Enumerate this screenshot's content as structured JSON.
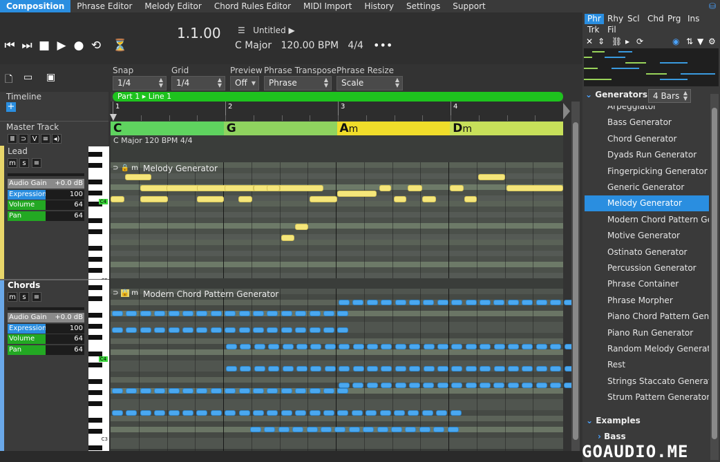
{
  "menu": {
    "tabs": [
      "Composition",
      "Phrase Editor",
      "Melody Editor",
      "Chord Rules Editor",
      "MIDI Import",
      "History",
      "Settings",
      "Support"
    ],
    "active_tab": "Composition"
  },
  "transport": {
    "position": "1.1.00",
    "title": "Untitled",
    "key": "C Major",
    "tempo": "120.00 BPM",
    "time_signature": "4/4",
    "more": "•••"
  },
  "controls": {
    "snap_label": "Snap",
    "snap_value": "1/4",
    "grid_label": "Grid",
    "grid_value": "1/4",
    "preview_label": "Preview",
    "preview_value": "Off",
    "transpose_label": "Phrase Transpose",
    "transpose_value": "Phrase",
    "resize_label": "Phrase Resize",
    "resize_value": "Scale"
  },
  "left_panel": {
    "timeline_label": "Timeline",
    "master_track_label": "Master Track",
    "tracks": [
      {
        "name": "Lead",
        "params": [
          {
            "name": "Audio Gain",
            "value": "+0.0 dB",
            "color": "#8a8a8a"
          },
          {
            "name": "Expression",
            "value": "100",
            "color": "#2a8ee0"
          },
          {
            "name": "Volume",
            "value": "64",
            "color": "#23a823"
          },
          {
            "name": "Pan",
            "value": "64",
            "color": "#23a823"
          }
        ]
      },
      {
        "name": "Chords",
        "params": [
          {
            "name": "Audio Gain",
            "value": "+0.0 dB",
            "color": "#8a8a8a"
          },
          {
            "name": "Expression",
            "value": "100",
            "color": "#2a8ee0"
          },
          {
            "name": "Volume",
            "value": "64",
            "color": "#23a823"
          },
          {
            "name": "Pan",
            "value": "64",
            "color": "#23a823"
          }
        ]
      }
    ],
    "key_labels": [
      "C4",
      "C5",
      "C4",
      "C3"
    ]
  },
  "arrangement": {
    "part_label": "Part 1 ▸ Line 1",
    "bars": [
      "1",
      "2",
      "3",
      "4"
    ],
    "chords": [
      {
        "root": "C",
        "suffix": "",
        "color": "#5fd35f"
      },
      {
        "root": "G",
        "suffix": "",
        "color": "#8fd35f"
      },
      {
        "root": "A",
        "suffix": "m",
        "color": "#f0dd2a"
      },
      {
        "root": "D",
        "suffix": "m",
        "color": "#c7e05a"
      }
    ],
    "chord_info": "C Major  120 BPM  4/4",
    "lanes": [
      {
        "generator": "Melody Generator"
      },
      {
        "generator": "Modern Chord Pattern Generator"
      }
    ]
  },
  "right_panel": {
    "tabs": [
      "Phr",
      "Rhy",
      "Scl",
      "Chd",
      "Prg",
      "Ins",
      "Trk",
      "Fil"
    ],
    "active_tab": "Phr",
    "generators_header": "Generators",
    "bars_value": "4 Bars",
    "generators": [
      "Arpeggiator",
      "Bass Generator",
      "Chord Generator",
      "Dyads Run Generator",
      "Fingerpicking Generator",
      "Generic Generator",
      "Melody Generator",
      "Modern Chord Pattern Generator",
      "Motive Generator",
      "Ostinato Generator",
      "Percussion Generator",
      "Phrase Container",
      "Phrase Morpher",
      "Piano Chord Pattern Generator",
      "Piano Run Generator",
      "Random Melody Generator",
      "Rest",
      "Strings Staccato Generator",
      "Strum Pattern Generator"
    ],
    "selected_generator": "Melody Generator",
    "examples_header": "Examples",
    "bass_header": "Bass"
  },
  "watermark": "GOAUDIO.ME"
}
